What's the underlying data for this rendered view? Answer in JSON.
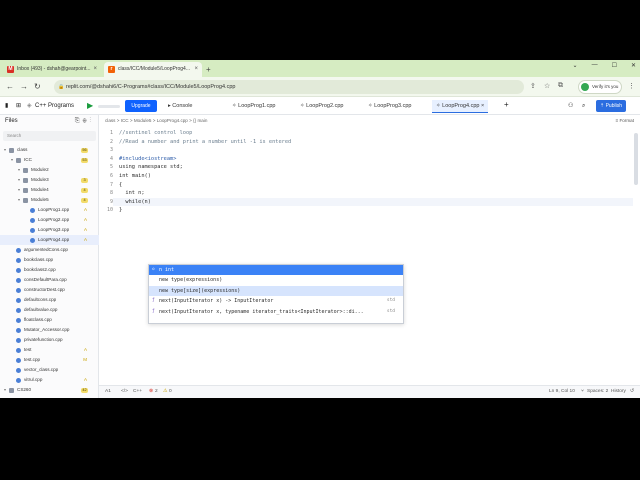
{
  "browser": {
    "tabs": [
      {
        "label": "Inbox (493) - dshah@gearpoint...",
        "fav": "M",
        "fav_color": "#d93025",
        "active": false
      },
      {
        "label": "class/ICC/Module5/LoopProg4...",
        "fav": "r",
        "fav_color": "#f26207",
        "active": true
      }
    ],
    "new_tab": "+",
    "url": "replit.com/@dshahi6/C-Programs#class/ICC/Module5/LoopProg4.cpp",
    "verify_label": "Verify it's you"
  },
  "replit": {
    "project_name": "C++ Programs",
    "upgrade_label": "Upgrade",
    "console_label": "Console",
    "editor_tabs": [
      "LoopProg1.cpp",
      "LoopProg2.cpp",
      "LoopProg3.cpp",
      "LoopProg4.cpp"
    ],
    "active_tab": "LoopProg4.cpp",
    "publish_label": "Publish"
  },
  "sidebar": {
    "title": "Files",
    "search_placeholder": "Search",
    "tree": [
      {
        "label": "class",
        "depth": 0,
        "type": "folder",
        "badge": "56"
      },
      {
        "label": "ICC",
        "depth": 1,
        "type": "folder",
        "badge": "53"
      },
      {
        "label": "Module2",
        "depth": 2,
        "type": "folder"
      },
      {
        "label": "Module3",
        "depth": 2,
        "type": "folder",
        "badge": "3"
      },
      {
        "label": "Module4",
        "depth": 2,
        "type": "folder",
        "badge": "4"
      },
      {
        "label": "Module5",
        "depth": 2,
        "type": "folder",
        "badge": "4"
      },
      {
        "label": "LoopProg1.cpp",
        "depth": 3,
        "type": "file",
        "mark": "A"
      },
      {
        "label": "LoopProg2.cpp",
        "depth": 3,
        "type": "file",
        "mark": "A"
      },
      {
        "label": "LoopProg3.cpp",
        "depth": 3,
        "type": "file",
        "mark": "A"
      },
      {
        "label": "LoopProg4.cpp",
        "depth": 3,
        "type": "file",
        "mark": "A",
        "selected": true
      },
      {
        "label": "argumentedCons.cpp",
        "depth": 1,
        "type": "file"
      },
      {
        "label": "bookclass.cpp",
        "depth": 1,
        "type": "file"
      },
      {
        "label": "bookclass2.cpp",
        "depth": 1,
        "type": "file"
      },
      {
        "label": "consDefaultPara.cpp",
        "depth": 1,
        "type": "file"
      },
      {
        "label": "constructorDest.cpp",
        "depth": 1,
        "type": "file"
      },
      {
        "label": "defaultcons.cpp",
        "depth": 1,
        "type": "file"
      },
      {
        "label": "defaultvalue.cpp",
        "depth": 1,
        "type": "file"
      },
      {
        "label": "floatclass.cpp",
        "depth": 1,
        "type": "file"
      },
      {
        "label": "Mutator_Accessor.cpp",
        "depth": 1,
        "type": "file"
      },
      {
        "label": "privatefunction.cpp",
        "depth": 1,
        "type": "file"
      },
      {
        "label": "test",
        "depth": 1,
        "type": "file",
        "mark": "A"
      },
      {
        "label": "test.cpp",
        "depth": 1,
        "type": "file",
        "mark": "M"
      },
      {
        "label": "vector_class.cpp",
        "depth": 1,
        "type": "file"
      },
      {
        "label": "vitrul.cpp",
        "depth": 1,
        "type": "file",
        "mark": "A"
      },
      {
        "label": "CS260",
        "depth": 0,
        "type": "folder",
        "badge": "42"
      }
    ]
  },
  "editor": {
    "breadcrumb": "class  >  ICC  >  Module5  >  LoopProg4.cpp  >  {}  main",
    "format_label": "Format",
    "line_numbers": [
      "1",
      "2",
      "3",
      "4",
      "5",
      "6",
      "7",
      "8",
      "9",
      "10"
    ],
    "lines": [
      "//sentinel control loop",
      "//Read a number and print a number until -1 is entered",
      "",
      "#include<iostream>",
      "using namespace std;",
      "int main()",
      "{",
      "  int n;",
      "  while(n)",
      "}"
    ]
  },
  "autocomplete": {
    "items": [
      {
        "label": "n   int",
        "icon": "◇",
        "detail": ""
      },
      {
        "label": "new type(expressions)",
        "icon": "",
        "detail": ""
      },
      {
        "label": "new type[size](expressions)",
        "icon": "",
        "detail": ""
      },
      {
        "label": "next(InputIterator x) -> InputIterator",
        "icon": "ƒ",
        "detail": "std"
      },
      {
        "label": "next(InputIterator x, typename iterator_traits<InputIterator>::di...",
        "icon": "ƒ",
        "detail": "std"
      }
    ]
  },
  "statusbar": {
    "left_a": "A1",
    "lang": "C++",
    "errors": "2",
    "warnings": "0",
    "position": "Ln 9, Col 10",
    "spaces": "Spaces: 2",
    "history": "History"
  }
}
